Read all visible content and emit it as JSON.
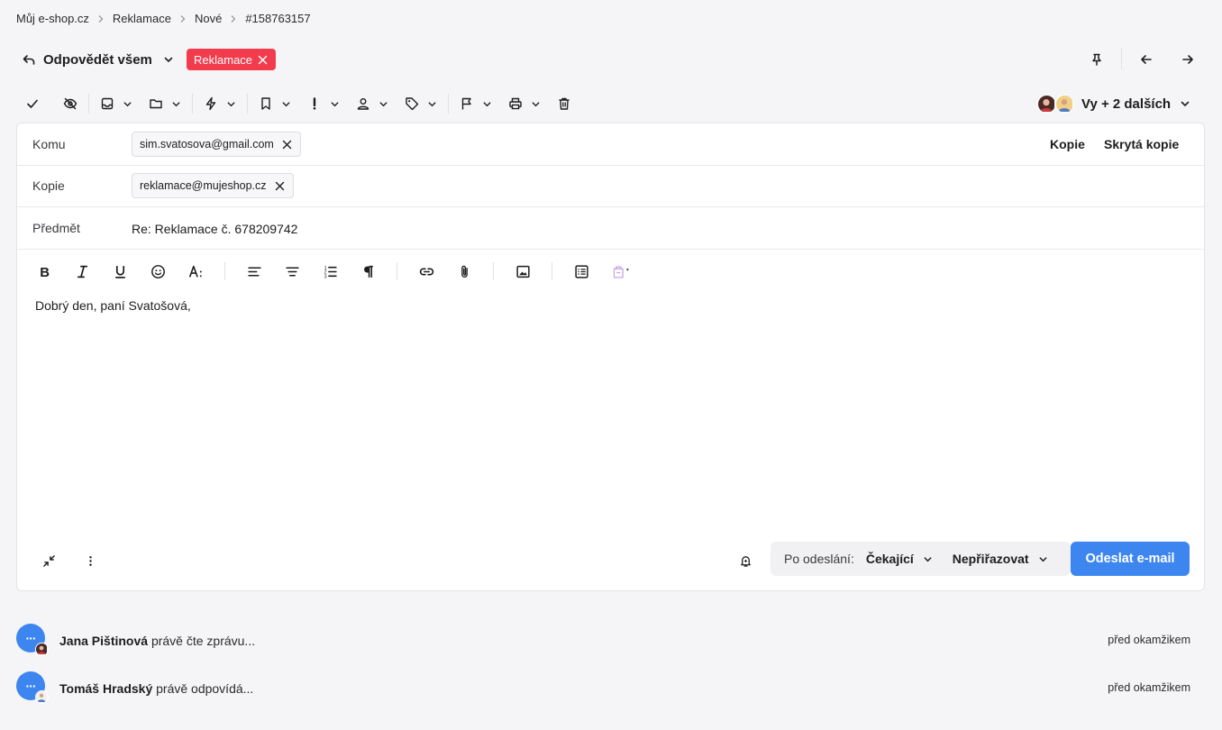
{
  "breadcrumb": [
    "Můj e-shop.cz",
    "Reklamace",
    "Nové",
    "#158763157"
  ],
  "header": {
    "reply_label": "Odpovědět všem",
    "tag_label": "Reklamace",
    "tag_color": "#f23c4d"
  },
  "toolbar": {
    "participants_label": "Vy + 2 dalších"
  },
  "composer": {
    "to_label": "Komu",
    "to_value": "sim.svatosova@gmail.com",
    "cc_link": "Kopie",
    "bcc_link": "Skrytá kopie",
    "cc_label": "Kopie",
    "cc_value": "reklamace@mujeshop.cz",
    "subject_label": "Předmět",
    "subject_value": "Re: Reklamace č. 678209742",
    "body": "Dobrý den, paní Svatošová,"
  },
  "footer": {
    "after_send_label": "Po odeslání:",
    "status_value": "Čekající",
    "assign_value": "Nepřiřazovat",
    "send_label": "Odeslat e-mail",
    "accent": "#3d86f0"
  },
  "activity": [
    {
      "name": "Jana Pištinová",
      "action": "právě čte zprávu...",
      "time": "před okamžikem",
      "bubble": "···"
    },
    {
      "name": "Tomáš Hradský",
      "action": "právě odpovídá...",
      "time": "před okamžikem",
      "bubble": "···"
    }
  ]
}
